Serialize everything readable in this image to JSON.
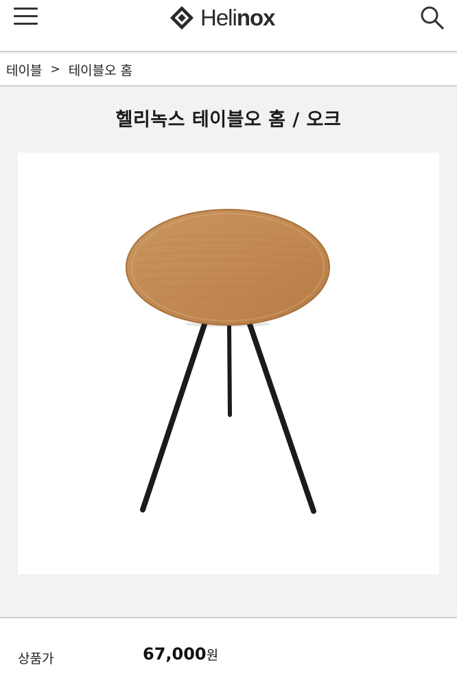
{
  "header": {
    "logo": {
      "text_a": "Heli",
      "text_b": "nox",
      "icon": "helinox-logo-icon"
    },
    "menu_icon": "hamburger-menu-icon",
    "search_icon": "search-icon"
  },
  "breadcrumb": {
    "items": [
      "테이블",
      "테이블오 홈"
    ],
    "separator": ">"
  },
  "product": {
    "title": "헬리녹스 테이블오 홈 / 오크",
    "image_alt": "round oak side table with three black legs",
    "price_label": "상품가",
    "price_value": "67,000",
    "price_unit": "원"
  },
  "colors": {
    "background": "#f2f2f2",
    "surface": "#ffffff",
    "divider": "#cfcfcf",
    "text": "#1a1a1a",
    "oak": "#c48c53",
    "legs": "#1b1b1b"
  }
}
